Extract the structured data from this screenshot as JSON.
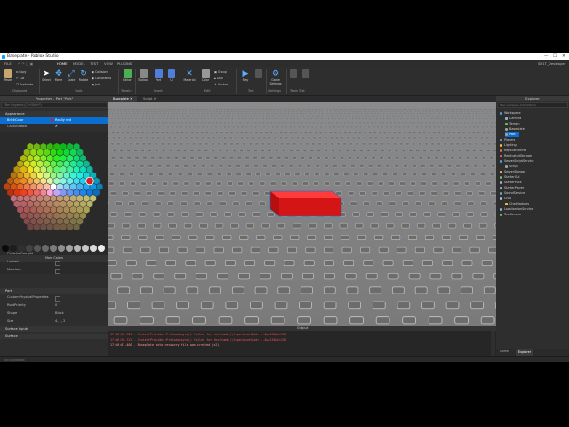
{
  "window": {
    "title": "Baseplate - Roblox Studio",
    "user": "SH1T_Developer"
  },
  "menu": {
    "file": "FILE",
    "tabs": [
      "HOME",
      "MODEL",
      "TEST",
      "VIEW",
      "PLUGINS"
    ]
  },
  "ribbon": {
    "clipboard": {
      "label": "Clipboard",
      "paste": "Paste",
      "copy": "Copy",
      "cut": "Cut",
      "duplicate": "Duplicate"
    },
    "tools": {
      "label": "Tools",
      "select": "Select",
      "move": "Move",
      "scale": "Scale",
      "rotate": "Rotate",
      "collisions": "Collisions",
      "constraints": "Constraints",
      "join": "Join"
    },
    "terrain": {
      "label": "Terrain",
      "editor": "Editor"
    },
    "insert": {
      "label": "Insert",
      "toolbox": "Toolbox",
      "part": "Part",
      "ui": "UI"
    },
    "edit": {
      "label": "Edit",
      "material": "Material",
      "color": "Color",
      "group": "Group",
      "lock": "Lock",
      "anchor": "Anchor"
    },
    "test": {
      "label": "Test",
      "play": "Play"
    },
    "settings": {
      "label": "Settings",
      "game_settings": "Game Settings"
    },
    "team_test": {
      "label": "Team Test"
    }
  },
  "properties": {
    "header": "Properties - Part \"Part\"",
    "filter_placeholder": "Filter Properties (Ctrl+Shift+P)",
    "section_appearance": "Appearance",
    "brickcolor": {
      "key": "BrickColor",
      "value": "Really red"
    },
    "castshadow": {
      "key": "CastShadow"
    },
    "more_colors": "More Colors",
    "collision_group": {
      "key": "CollisionGroupId"
    },
    "locked": {
      "key": "Locked"
    },
    "massless": {
      "key": "Massless"
    },
    "section_part": "Part",
    "custom_physical": {
      "key": "CustomPhysicalProperties"
    },
    "root_priority": {
      "key": "RootPriority",
      "value": "0"
    },
    "shape": {
      "key": "Shape",
      "value": "Block"
    },
    "size": {
      "key": "Size",
      "value": "4, 1, 2"
    },
    "section_surface_inputs": "Surface Inputs",
    "section_surface": "Surface"
  },
  "viewport_tabs": {
    "baseplate": "Baseplate",
    "script": "Script"
  },
  "output": {
    "title": "Output",
    "lines": [
      {
        "text": "17:16:26.722 - ContentProvider:PreloadAsync() failed for rbxthumb://type=Asset&id=...&w=150&h=150",
        "color": "#ff5050"
      },
      {
        "text": "17:16:26.722 - ContentProvider:PreloadAsync() failed for rbxthumb://type=Asset&id=...&w=150&h=150",
        "color": "#ff5050"
      },
      {
        "text": "17:20:07.400 - Baseplate auto-recovery file was created (x2)",
        "color": "#ff9999"
      }
    ]
  },
  "explorer": {
    "header": "Explorer",
    "filter_placeholder": "Filter workspace (Ctrl+Shift+X)",
    "items": [
      {
        "label": "Workspace",
        "indent": 0,
        "color": "#4aa3df",
        "selected": false
      },
      {
        "label": "Camera",
        "indent": 1,
        "color": "#8ab4d8",
        "selected": false
      },
      {
        "label": "Terrain",
        "indent": 1,
        "color": "#6fbf5a",
        "selected": false
      },
      {
        "label": "Baseplate",
        "indent": 1,
        "color": "#9aa0a6",
        "selected": false
      },
      {
        "label": "Part",
        "indent": 1,
        "color": "#9aa0a6",
        "selected": true
      },
      {
        "label": "Players",
        "indent": 0,
        "color": "#5b9bd5",
        "selected": false
      },
      {
        "label": "Lighting",
        "indent": 0,
        "color": "#f1c232",
        "selected": false
      },
      {
        "label": "ReplicatedFirst",
        "indent": 0,
        "color": "#e06666",
        "selected": false
      },
      {
        "label": "ReplicatedStorage",
        "indent": 0,
        "color": "#e06666",
        "selected": false
      },
      {
        "label": "ServerScriptService",
        "indent": 0,
        "color": "#4aa3df",
        "selected": false
      },
      {
        "label": "Script",
        "indent": 1,
        "color": "#9aa0a6",
        "selected": false
      },
      {
        "label": "ServerStorage",
        "indent": 0,
        "color": "#f6b26b",
        "selected": false
      },
      {
        "label": "StarterGui",
        "indent": 0,
        "color": "#6fbf5a",
        "selected": false
      },
      {
        "label": "StarterPack",
        "indent": 0,
        "color": "#b4a7d6",
        "selected": false
      },
      {
        "label": "StarterPlayer",
        "indent": 0,
        "color": "#8ab4d8",
        "selected": false
      },
      {
        "label": "SoundService",
        "indent": 0,
        "color": "#76a5af",
        "selected": false
      },
      {
        "label": "Chat",
        "indent": 0,
        "color": "#9fc5e8",
        "selected": false
      },
      {
        "label": "ChatModules",
        "indent": 1,
        "color": "#f1c232",
        "selected": false
      },
      {
        "label": "LocalizationService",
        "indent": 0,
        "color": "#8ab4d8",
        "selected": false
      },
      {
        "label": "TestService",
        "indent": 0,
        "color": "#6fbf5a",
        "selected": false
      }
    ],
    "tabs": {
      "game": "Game",
      "explorer": "Explorer"
    }
  },
  "statusbar": {
    "command_placeholder": "Run a command"
  },
  "colors": {
    "selected_part": "#e01b1b",
    "accent": "#0a6fd0",
    "baseplate": "#7a7776"
  }
}
